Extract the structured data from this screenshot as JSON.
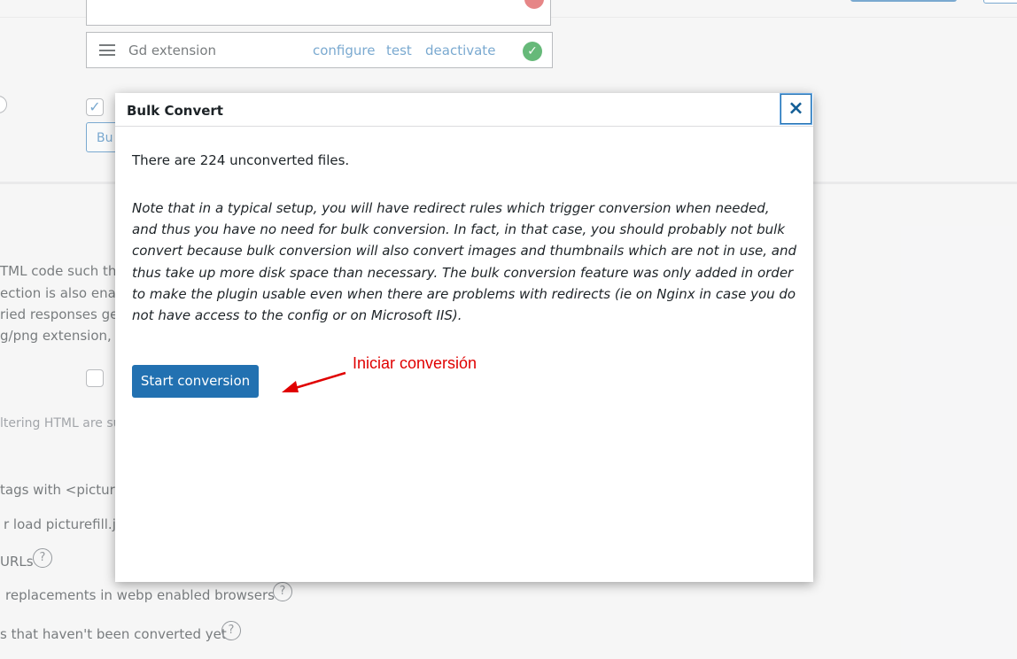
{
  "background": {
    "converter_row": {
      "name": "Gd extension",
      "links": [
        "configure",
        "test",
        "deactivate"
      ],
      "status": "check-icon"
    },
    "bulk_button_label": "Bu",
    "text_lines": [
      "TML code such tha",
      "ection is also enab",
      "ried responses ge",
      "g/png extension, e"
    ],
    "filter_note": "ltering HTML are su",
    "option_lines": [
      "tags with <picture",
      "r load picturefill.js",
      "URLs",
      "replacements in webp enabled browsers",
      "s that haven't been converted yet"
    ]
  },
  "dialog": {
    "title": "Bulk Convert",
    "close_label": "×",
    "count_text": "There are 224 unconverted files.",
    "note": "Note that in a typical setup, you will have redirect rules which trigger conversion when needed, and thus you have no need for bulk conversion. In fact, in that case, you should probably not bulk convert because bulk conversion will also convert images and thumbnails which are not in use, and thus take up more disk space than necessary. The bulk conversion feature was only added in order to make the plugin usable even when there are problems with redirects (ie on Nginx in case you do not have access to the config or on Microsoft IIS).",
    "start_button": "Start conversion"
  },
  "annotation": {
    "text": "Iniciar conversión",
    "color": "#e00000"
  },
  "colors": {
    "primary": "#2271b1",
    "success": "#008a20"
  }
}
